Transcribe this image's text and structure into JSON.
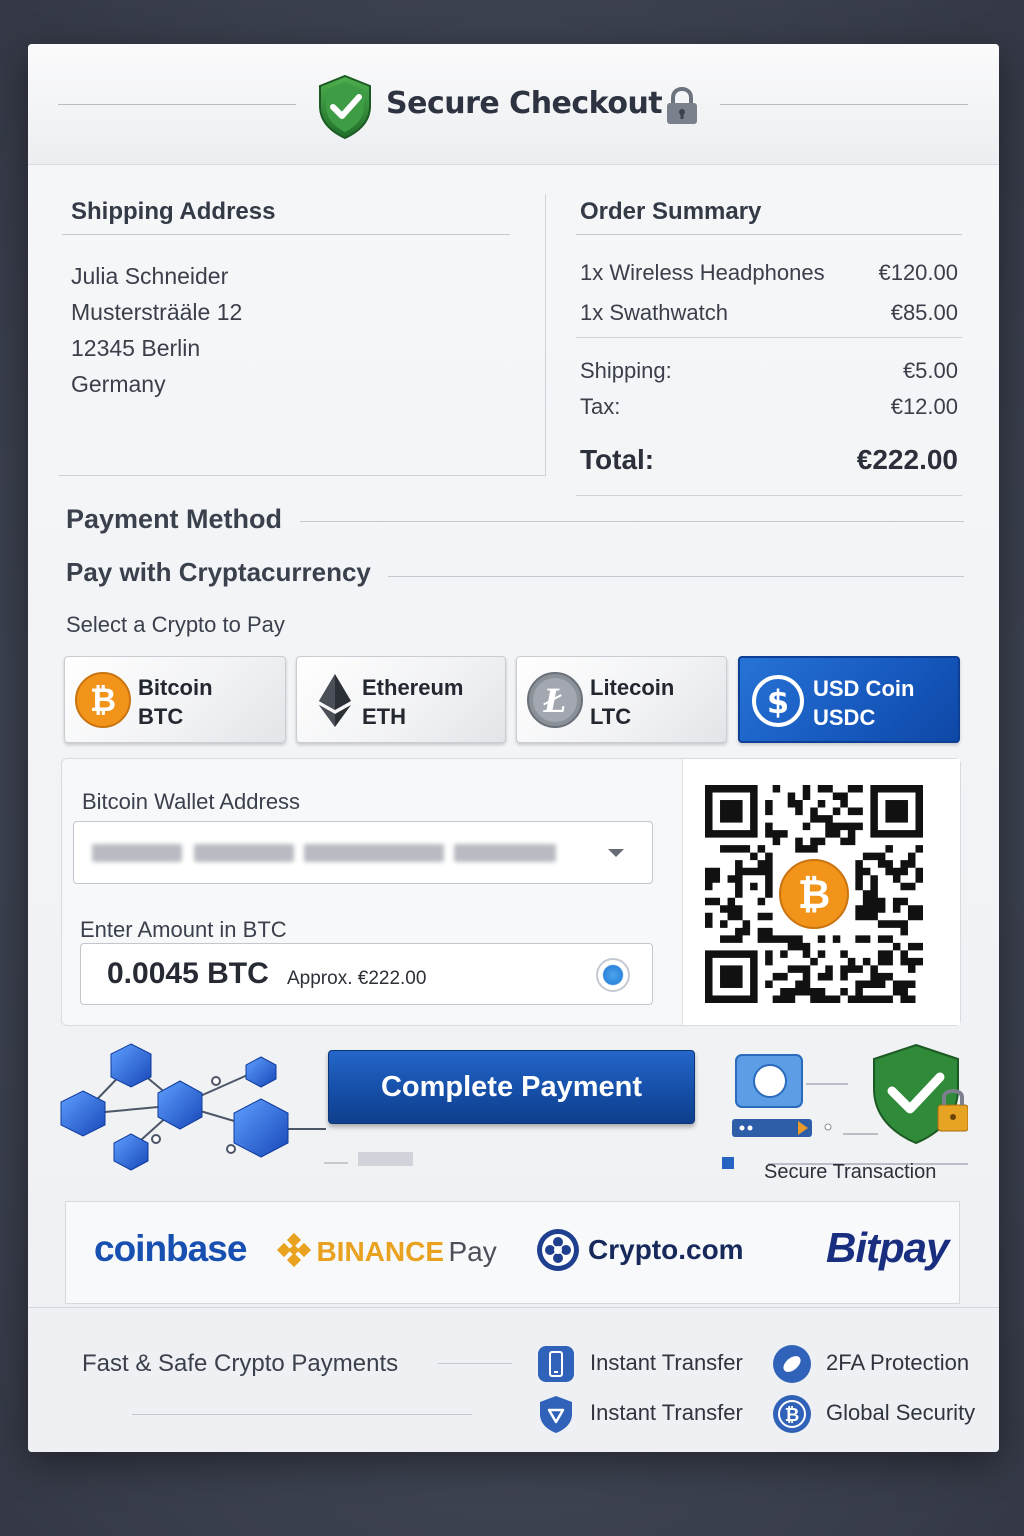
{
  "header": {
    "title": "Secure Checkout"
  },
  "shipping": {
    "title": "Shipping Address",
    "lines": [
      "Julia Schneider",
      "Mustersträäle 12",
      "12345 Berlin",
      "Germany"
    ]
  },
  "order": {
    "title": "Order Summary",
    "items": [
      {
        "label": "1x Wireless Headphones",
        "amount": "€120.00"
      },
      {
        "label": "1x Swathwatch",
        "amount": "€85.00"
      }
    ],
    "shipping_label": "Shipping:",
    "shipping_amount": "€5.00",
    "tax_label": "Tax:",
    "tax_amount": "€12.00",
    "total_label": "Total:",
    "total_amount": "€222.00"
  },
  "payment": {
    "method_title": "Payment Method",
    "crypto_title": "Pay with Cryptacurrency",
    "select_label": "Select a Crypto to Pay",
    "coins": [
      {
        "name": "Bitcoin",
        "code": "BTC",
        "icon": "bitcoin-icon",
        "selected": false
      },
      {
        "name": "Ethereum",
        "code": "ETH",
        "icon": "ethereum-icon",
        "selected": false
      },
      {
        "name": "Litecoin",
        "code": "LTC",
        "icon": "litecoin-icon",
        "selected": false
      },
      {
        "name": "USD Coin",
        "code": "USDC",
        "icon": "usdc-icon",
        "selected": true
      }
    ],
    "wallet_label": "Bitcoin Wallet Address",
    "amount_label": "Enter Amount in BTC",
    "amount_value": "0.0045 BTC",
    "approx": "Approx. €222.00",
    "submit_label": "Complete Payment",
    "secure_label": "Secure Transaction"
  },
  "providers": {
    "coinbase": "coinbase",
    "binance_brand": "BINANCE",
    "binance_pay": "Pay",
    "cryptocom": "Crypto.com",
    "bitpay": "Bitpay"
  },
  "footer": {
    "tagline": "Fast & Safe Crypto Payments",
    "features": [
      {
        "label": "Instant Transfer",
        "icon": "phone-icon"
      },
      {
        "label": "2FA Protection",
        "icon": "shield-2fa-icon"
      },
      {
        "label": "Instant Transfer",
        "icon": "shield-icon"
      },
      {
        "label": "Global Security",
        "icon": "bitcoin-badge-icon"
      }
    ]
  },
  "colors": {
    "accent": "#1658bd",
    "bitcoin": "#f2931a",
    "shield_green": "#2f8a3a",
    "binance": "#e8a21f",
    "bitpay": "#1a2e80"
  }
}
